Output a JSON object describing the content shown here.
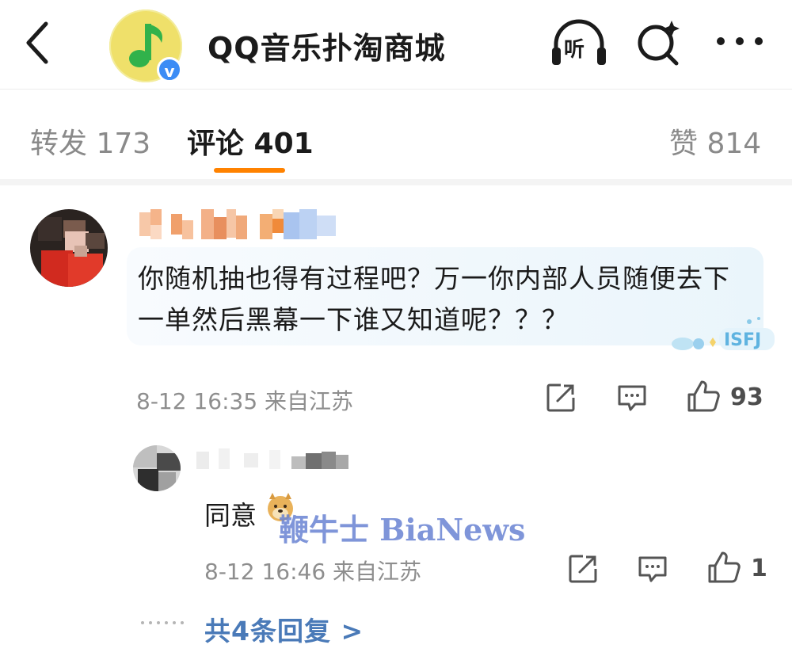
{
  "header": {
    "title": "QQ音乐扑淘商城",
    "listen_label": "听",
    "verified_mark": "v",
    "icons": [
      "back-icon",
      "music-note-icon",
      "verified-icon",
      "headphones-icon",
      "search-sparkle-icon",
      "more-icon"
    ]
  },
  "tabs": [
    {
      "label": "转发 173",
      "active": false
    },
    {
      "label": "评论 401",
      "active": true
    },
    {
      "label": "赞 814",
      "active": false
    }
  ],
  "comment": {
    "text": "你随机抽也得有过程吧？万一你内部人员随便去下一单然后黑幕一下谁又知道呢？？？",
    "timestamp_location": "8-12 16:35 来自江苏",
    "likes": "93",
    "sticker_text": "ISFJ"
  },
  "reply": {
    "text": "同意",
    "timestamp_location": "8-12 16:46 来自江苏",
    "likes": "1",
    "more_replies": "共4条回复 >"
  },
  "watermark": "鞭牛士 BiaNews",
  "colors": {
    "accent": "#ff8200",
    "link": "#4a7ab8",
    "muted": "#8e8e8e",
    "verified": "#3b8cf5",
    "bubble": "#eef6fb"
  }
}
